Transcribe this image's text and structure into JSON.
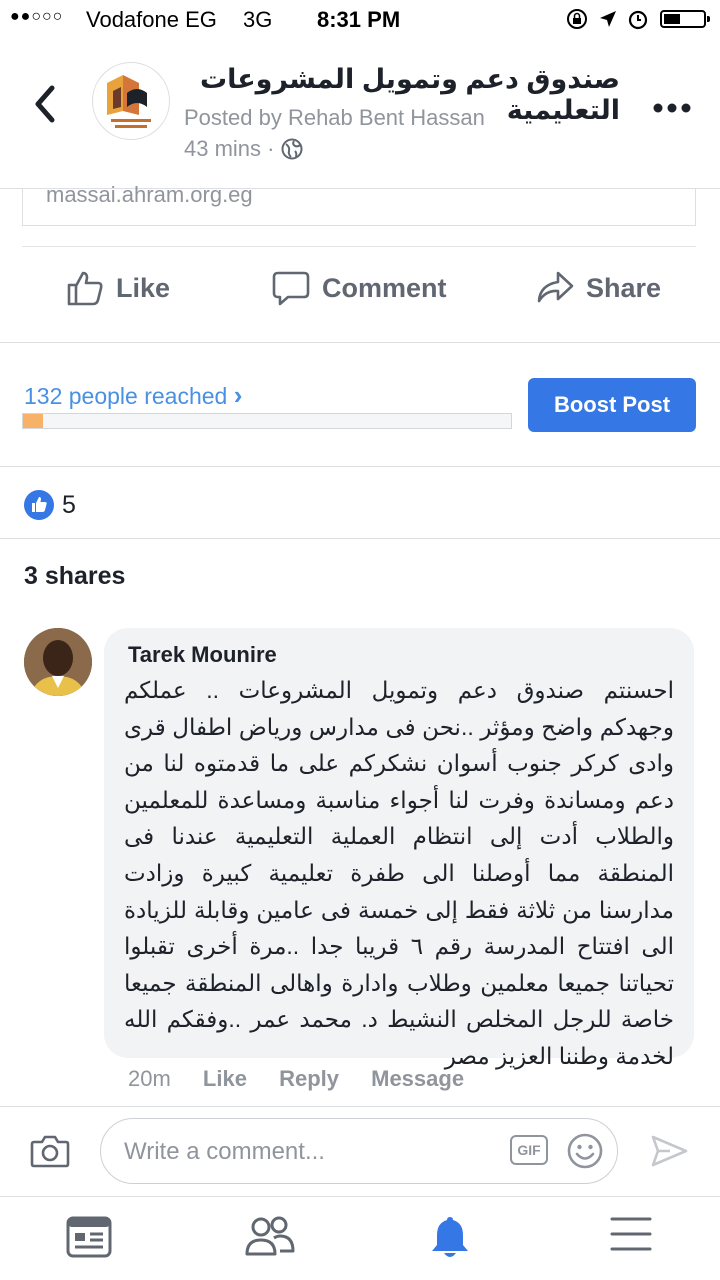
{
  "status_bar": {
    "signal": "●●○○○",
    "carrier": "Vodafone EG",
    "network": "3G",
    "time": "8:31 PM"
  },
  "header": {
    "page_title": "صندوق دعم وتمويل المشروعات التعليمية",
    "posted_by": "Posted by Rehab Bent Hassan",
    "time_ago": "43 mins ·",
    "avatar_icon": "fund-logo-icon",
    "privacy_icon": "globe-icon"
  },
  "link_preview": {
    "url": "massai.ahram.org.eg"
  },
  "actions": {
    "like": "Like",
    "comment": "Comment",
    "share": "Share"
  },
  "reach": {
    "text": "132 people reached",
    "chevron": "›",
    "progress_fraction": 0.04,
    "progress_color": "#f7b267",
    "boost_label": "Boost Post",
    "boost_color": "#3578e5"
  },
  "reactions": {
    "count": "5"
  },
  "shares": {
    "text": "3 shares"
  },
  "comment": {
    "author": "Tarek Mounire",
    "text": "احسنتم صندوق دعم وتمويل المشروعات .. عملكم وجهدكم واضح ومؤثر ..نحن فى مدارس ورياض اطفال قرى وادى كركر جنوب أسوان نشكركم على ما قدمتوه لنا من دعم ومساندة وفرت لنا أجواء مناسبة ومساعدة للمعلمين والطلاب أدت إلى انتظام العملية التعليمية عندنا فى المنطقة مما أوصلنا الى طفرة تعليمية كبيرة وزادت مدارسنا من ثلاثة فقط إلى خمسة فى عامين وقابلة للزيادة الى افتتاح المدرسة رقم ٦ قريبا جدا ..مرة أخرى تقبلوا تحياتنا جميعا معلمين وطلاب وادارة واهالى المنطقة جميعا خاصة للرجل المخلص النشيط د. محمد عمر ..وفقكم الله لخدمة وطننا العزيز مصر",
    "time": "20m",
    "like": "Like",
    "reply": "Reply",
    "message": "Message"
  },
  "composer": {
    "placeholder": "Write a comment...",
    "gif_label": "GIF"
  },
  "tab_bar": {
    "items": [
      "news-feed-icon",
      "friends-icon",
      "notifications-icon",
      "menu-icon"
    ],
    "active_color": "#3578e5"
  }
}
